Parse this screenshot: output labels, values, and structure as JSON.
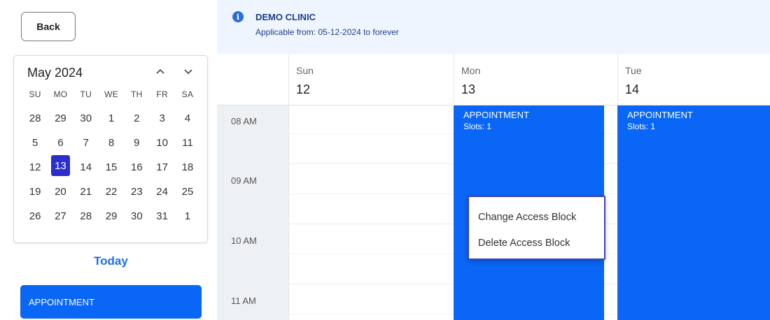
{
  "sidebar": {
    "back_label": "Back",
    "calendar": {
      "month_title": "May 2024",
      "prev_icon": "chevron-up-icon",
      "next_icon": "chevron-down-icon",
      "weekday_headers": [
        "SU",
        "MO",
        "TU",
        "WE",
        "TH",
        "FR",
        "SA"
      ],
      "weeks": [
        [
          "28",
          "29",
          "30",
          "1",
          "2",
          "3",
          "4"
        ],
        [
          "5",
          "6",
          "7",
          "8",
          "9",
          "10",
          "11"
        ],
        [
          "12",
          "13",
          "14",
          "15",
          "16",
          "17",
          "18"
        ],
        [
          "19",
          "20",
          "21",
          "22",
          "23",
          "24",
          "25"
        ],
        [
          "26",
          "27",
          "28",
          "29",
          "30",
          "31",
          "1"
        ]
      ],
      "selected_day": "13"
    },
    "today_label": "Today",
    "appointment_label": "APPOINTMENT"
  },
  "info": {
    "icon": "info-icon",
    "title": "DEMO CLINIC",
    "subtitle": "Applicable from: 05-12-2024 to forever"
  },
  "days": [
    {
      "name": "Sun",
      "number": "12"
    },
    {
      "name": "Mon",
      "number": "13"
    },
    {
      "name": "Tue",
      "number": "14"
    }
  ],
  "times": [
    "08 AM",
    "09 AM",
    "10 AM",
    "11 AM"
  ],
  "blocks": [
    {
      "title": "APPOINTMENT",
      "slots": "Slots: 1"
    },
    {
      "title": "APPOINTMENT",
      "slots": "Slots: 1"
    }
  ],
  "context_menu": {
    "change_label": "Change Access Block",
    "delete_label": "Delete Access Block"
  },
  "colors": {
    "accent": "#0a66f5",
    "selected": "#2a2fcc",
    "info_bg": "#eff5ff"
  }
}
